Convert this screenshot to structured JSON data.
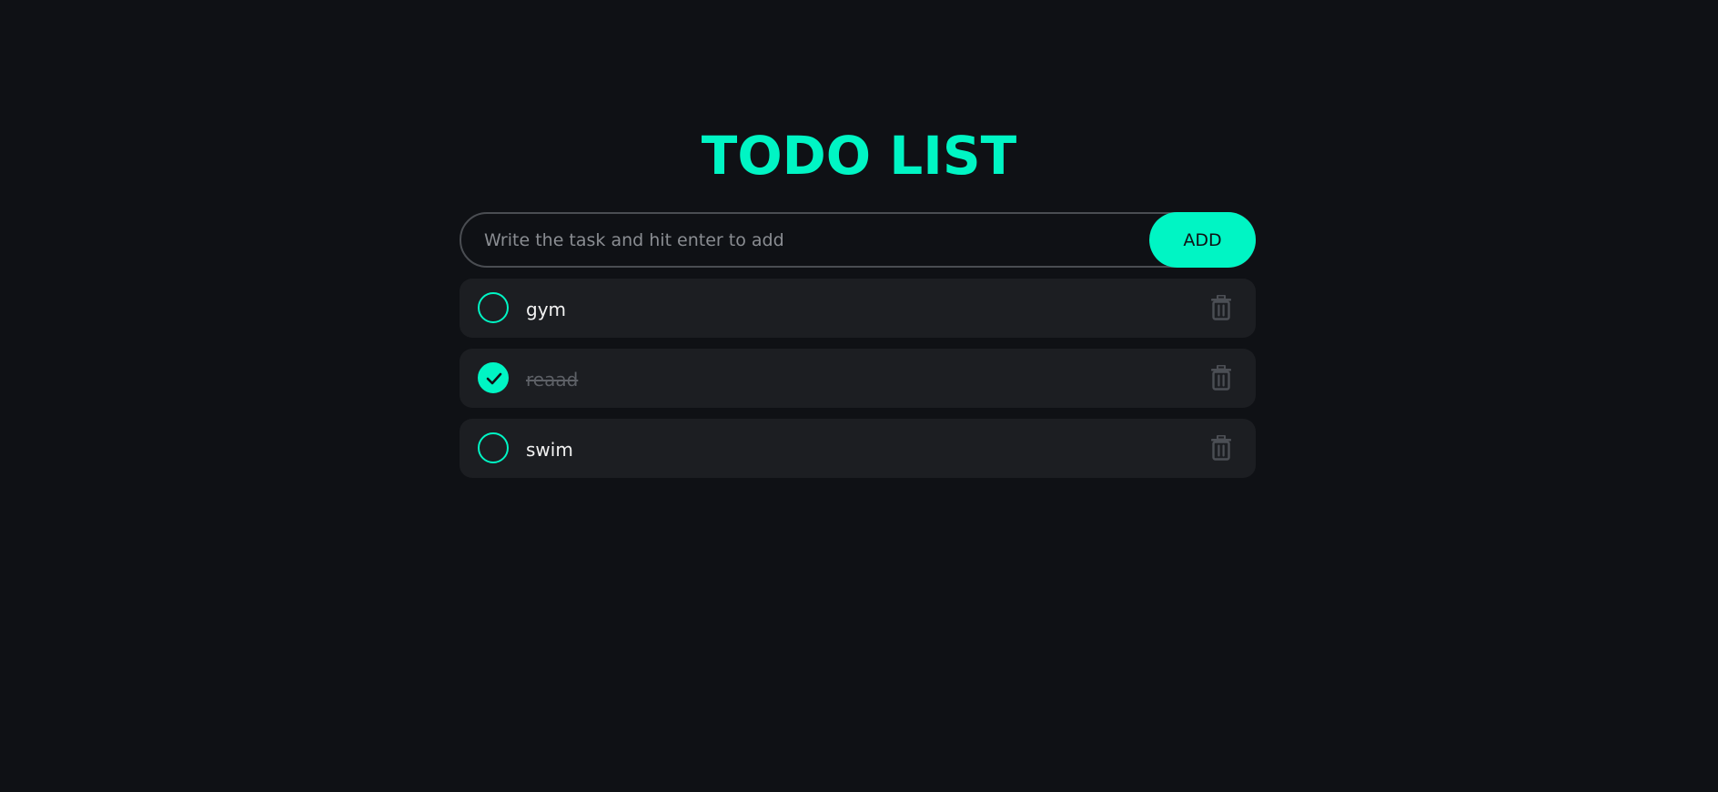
{
  "header": {
    "title": "TODO LIST"
  },
  "composer": {
    "placeholder": "Write the task and hit enter to add",
    "value": "",
    "add_label": "ADD"
  },
  "todos": [
    {
      "text": "gym",
      "completed": false,
      "icon": "trash-icon"
    },
    {
      "text": "reaad",
      "completed": true,
      "icon": "trash-icon"
    },
    {
      "text": "swim",
      "completed": false,
      "icon": "trash-icon"
    }
  ],
  "colors": {
    "background": "#0f1115",
    "accent": "#00f5c4",
    "card": "#1c1e22",
    "muted_text": "#5d6066"
  }
}
